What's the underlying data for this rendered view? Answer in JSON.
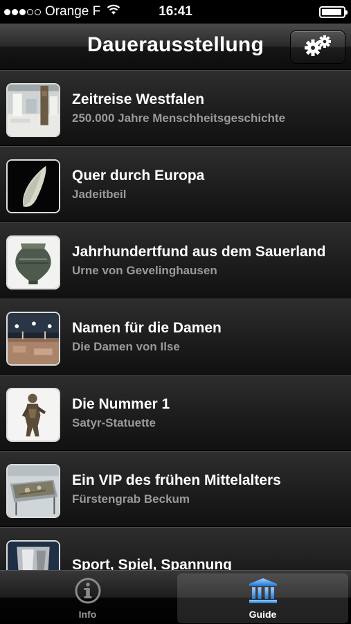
{
  "status_bar": {
    "carrier": "Orange F",
    "time": "16:41",
    "signal_bars_filled": 3,
    "signal_bars_total": 5,
    "battery_level": 0.95
  },
  "nav": {
    "title": "Dauerausstellung",
    "settings_icon": "gears-icon"
  },
  "exhibits": [
    {
      "title": "Zeitreise Westfalen",
      "subtitle": "250.000 Jahre Menschheitsgeschichte",
      "thumb": "museum-hall"
    },
    {
      "title": "Quer durch Europa",
      "subtitle": "Jadeitbeil",
      "thumb": "jade-axe"
    },
    {
      "title": "Jahrhundertfund aus dem Sauerland",
      "subtitle": "Urne von Gevelinghausen",
      "thumb": "bronze-urn"
    },
    {
      "title": "Namen für die Damen",
      "subtitle": "Die Damen von Ilse",
      "thumb": "excavation-night"
    },
    {
      "title": "Die Nummer 1",
      "subtitle": "Satyr-Statuette",
      "thumb": "bronze-statuette"
    },
    {
      "title": "Ein VIP des frühen Mittelalters",
      "subtitle": "Fürstengrab Beckum",
      "thumb": "grave-display"
    },
    {
      "title": "Sport, Spiel, Spannung",
      "subtitle": "",
      "thumb": "silver-cup"
    }
  ],
  "tabs": [
    {
      "label": "Info",
      "icon": "info-icon",
      "selected": false
    },
    {
      "label": "Guide",
      "icon": "museum-icon",
      "selected": true
    }
  ],
  "colors": {
    "subtitle": "#9a9a9a",
    "selected_tab_label": "#ffffff",
    "unselected_tab_label": "#999999"
  }
}
